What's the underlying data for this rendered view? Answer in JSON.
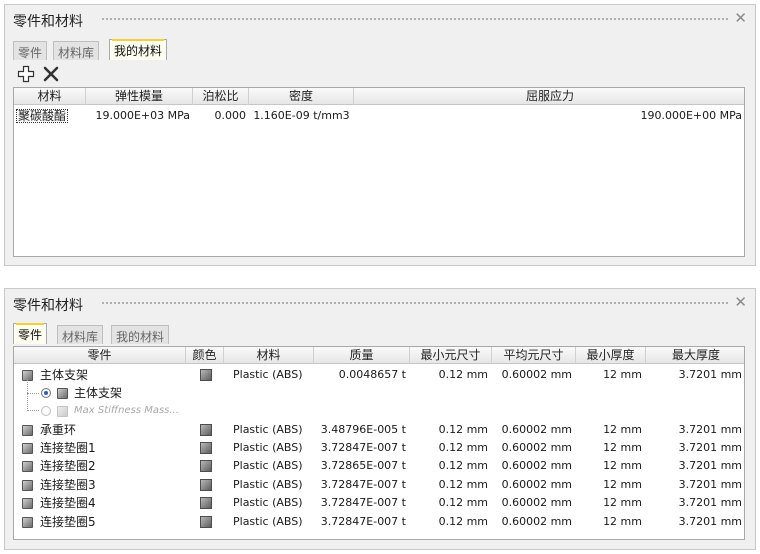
{
  "panel1": {
    "title": "零件和材料",
    "tabs": [
      "零件",
      "材料库",
      "我的材料"
    ],
    "active_tab": "我的材料",
    "toolbar": {
      "add_icon": "plus-icon",
      "delete_icon": "x-delete-icon"
    },
    "columns": [
      "材料",
      "弹性模量",
      "泊松比",
      "密度",
      "屈服应力"
    ],
    "rows": [
      {
        "name": "聚碳酸酯",
        "modulus": "19.000E+03 MPa",
        "poisson": "0.000",
        "density": "1.160E-09 t/mm3",
        "yield": "190.000E+00 MPa"
      }
    ]
  },
  "panel2": {
    "title": "零件和材料",
    "tabs": [
      "零件",
      "材料库",
      "我的材料"
    ],
    "active_tab": "零件",
    "columns": [
      "零件",
      "颜色",
      "材料",
      "质量",
      "最小元尺寸",
      "平均元尺寸",
      "最小厚度",
      "最大厚度"
    ],
    "rows": [
      {
        "name": "主体支架",
        "material": "Plastic (ABS)",
        "mass": "0.0048657 t",
        "min_elem": "0.12 mm",
        "avg_elem": "0.60002 mm",
        "min_thick": "12 mm",
        "max_thick": "3.7201 mm"
      },
      {
        "name": "承重环",
        "material": "Plastic (ABS)",
        "mass": "3.48796E-005 t",
        "min_elem": "0.12 mm",
        "avg_elem": "0.60002 mm",
        "min_thick": "12 mm",
        "max_thick": "3.7201 mm"
      },
      {
        "name": "连接垫圈1",
        "material": "Plastic (ABS)",
        "mass": "3.72847E-007 t",
        "min_elem": "0.12 mm",
        "avg_elem": "0.60002 mm",
        "min_thick": "12 mm",
        "max_thick": "3.7201 mm"
      },
      {
        "name": "连接垫圈2",
        "material": "Plastic (ABS)",
        "mass": "3.72865E-007 t",
        "min_elem": "0.12 mm",
        "avg_elem": "0.60002 mm",
        "min_thick": "12 mm",
        "max_thick": "3.7201 mm"
      },
      {
        "name": "连接垫圈3",
        "material": "Plastic (ABS)",
        "mass": "3.72847E-007 t",
        "min_elem": "0.12 mm",
        "avg_elem": "0.60002 mm",
        "min_thick": "12 mm",
        "max_thick": "3.7201 mm"
      },
      {
        "name": "连接垫圈4",
        "material": "Plastic (ABS)",
        "mass": "3.72847E-007 t",
        "min_elem": "0.12 mm",
        "avg_elem": "0.60002 mm",
        "min_thick": "12 mm",
        "max_thick": "3.7201 mm"
      },
      {
        "name": "连接垫圈5",
        "material": "Plastic (ABS)",
        "mass": "3.72847E-007 t",
        "min_elem": "0.12 mm",
        "avg_elem": "0.60002 mm",
        "min_thick": "12 mm",
        "max_thick": "3.7201 mm"
      }
    ],
    "subitems": [
      {
        "label": "主体支架",
        "selected": true
      },
      {
        "label": "Max Stiffness Mass...",
        "selected": false
      }
    ]
  }
}
